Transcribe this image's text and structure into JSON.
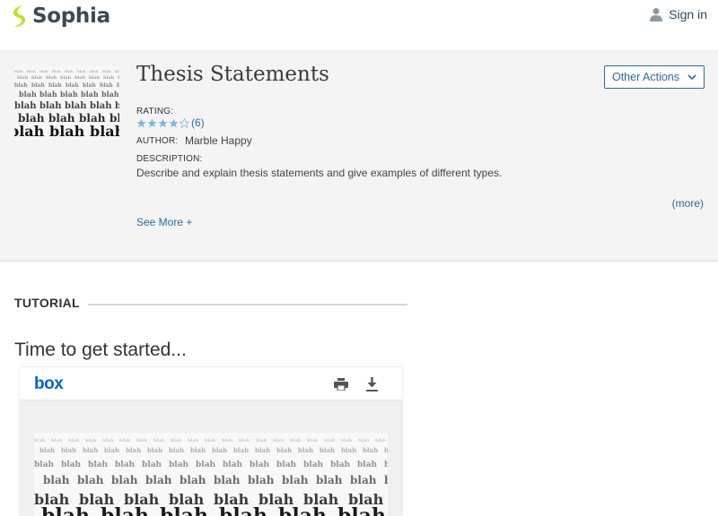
{
  "header": {
    "brand": "Sophia",
    "sign_in_label": "Sign in"
  },
  "resource": {
    "title": "Thesis Statements",
    "other_actions_label": "Other Actions",
    "rating_label": "RATING:",
    "rating_value": 4,
    "rating_max": 5,
    "rating_count": "(6)",
    "author_label": "AUTHOR:",
    "author_name": "Marble Happy",
    "description_label": "DESCRIPTION:",
    "description_text": "Describe and explain thesis statements and give examples of different types.",
    "more_label": "(more)",
    "see_more_label": "See More +",
    "thumbnail_word": "blah"
  },
  "tutorial": {
    "heading": "TUTORIAL",
    "section_title": "Time to get started..."
  },
  "viewer": {
    "logo_text": "box",
    "print_icon": "print-icon",
    "download_icon": "download-icon",
    "page_word": "blah"
  },
  "colors": {
    "brand_green": "#c4dd2c",
    "link_blue": "#2a6ba3",
    "star_blue": "#7fb8e0",
    "box_blue": "#0061d5"
  }
}
